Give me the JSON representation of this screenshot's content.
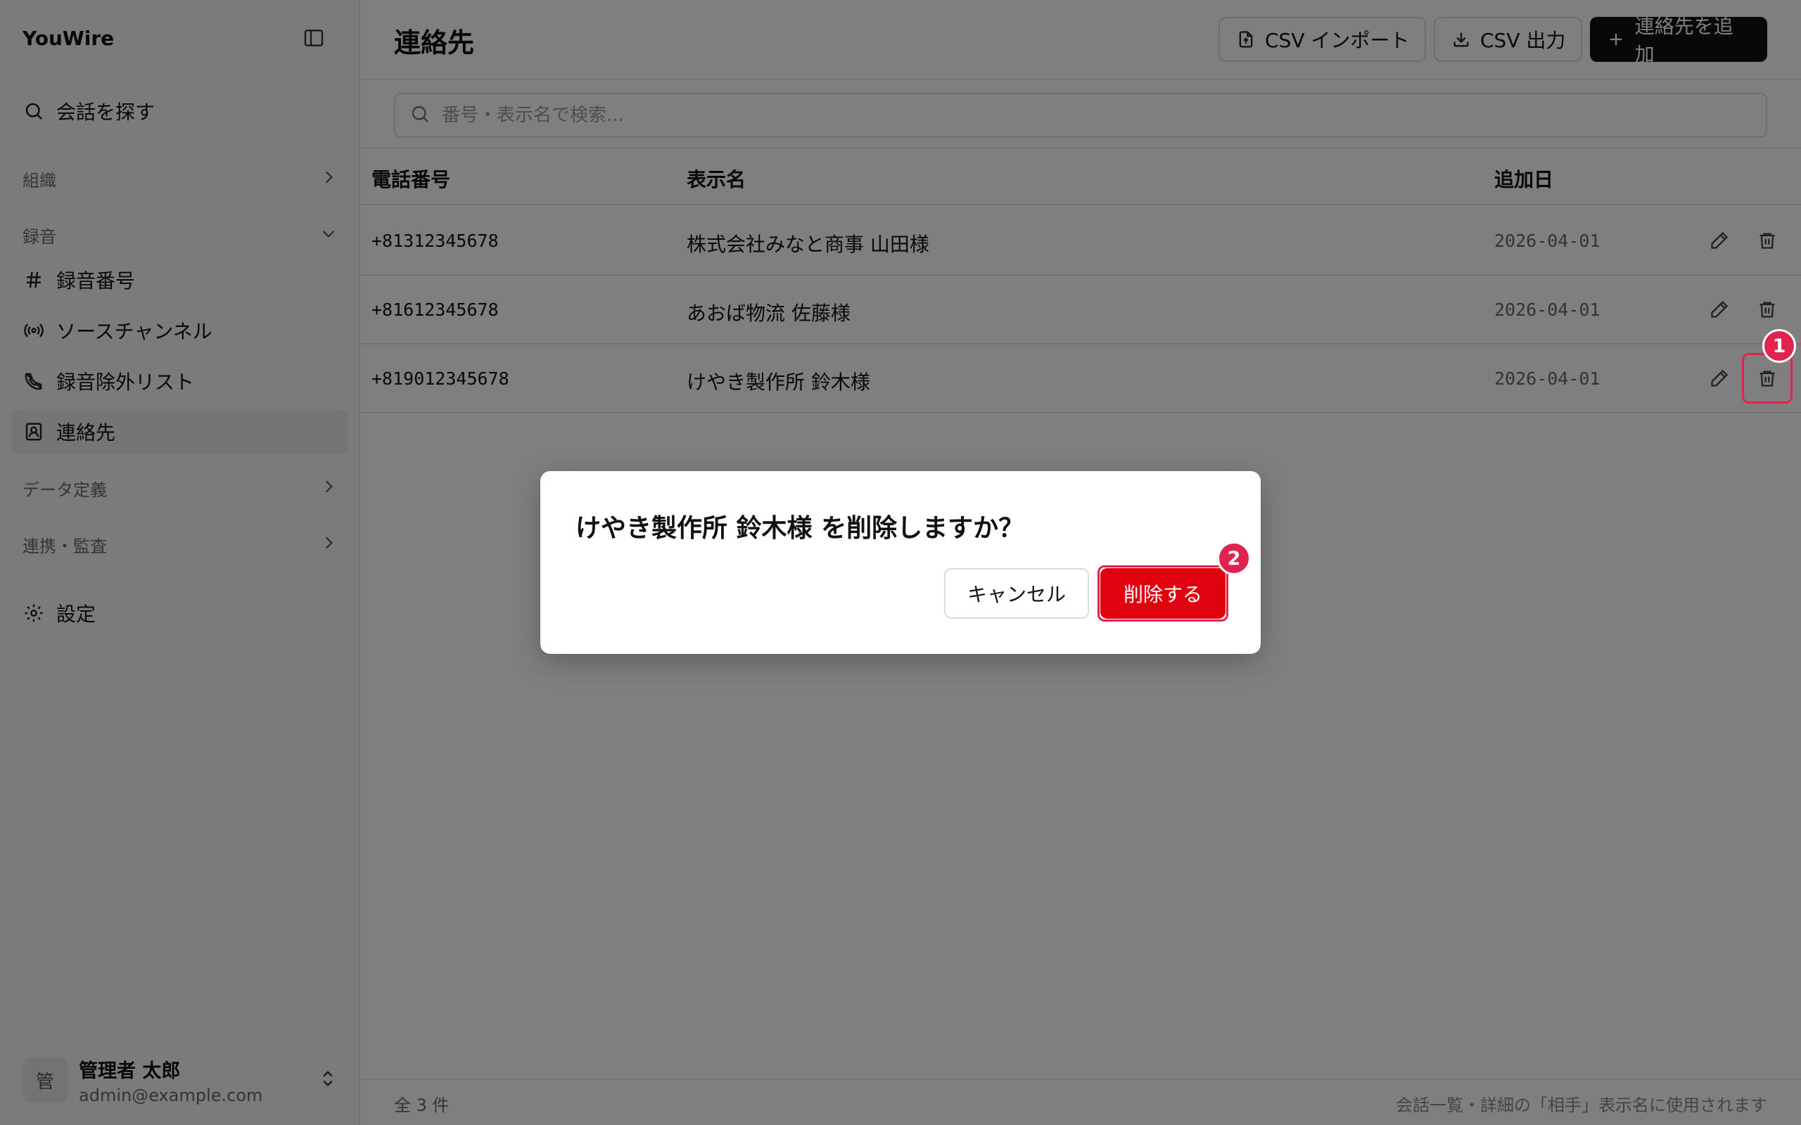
{
  "sidebar": {
    "brand": "YouWire",
    "search_label": "会話を探す",
    "group_org": "組織",
    "group_recording": "録音",
    "items": [
      {
        "label": "録音番号"
      },
      {
        "label": "ソースチャンネル"
      },
      {
        "label": "録音除外リスト"
      },
      {
        "label": "連絡先"
      }
    ],
    "group_data": "データ定義",
    "group_integration": "連携・監査",
    "settings_label": "設定",
    "user": {
      "avatar": "管",
      "name": "管理者 太郎",
      "email": "admin@example.com"
    }
  },
  "header": {
    "title": "連絡先",
    "csv_import": "CSV インポート",
    "csv_export": "CSV 出力",
    "add_contact": "連絡先を追加"
  },
  "search": {
    "placeholder": "番号・表示名で検索..."
  },
  "table": {
    "columns": {
      "phone": "電話番号",
      "name": "表示名",
      "added": "追加日"
    },
    "rows": [
      {
        "phone": "+81312345678",
        "name": "株式会社みなと商事 山田様",
        "added": "2026-04-01"
      },
      {
        "phone": "+81612345678",
        "name": "あおば物流 佐藤様",
        "added": "2026-04-01"
      },
      {
        "phone": "+819012345678",
        "name": "けやき製作所 鈴木様",
        "added": "2026-04-01"
      }
    ]
  },
  "footer": {
    "count": "全 3 件",
    "note": "会話一覧・詳細の「相手」表示名に使用されます"
  },
  "dialog": {
    "title": "けやき製作所 鈴木様 を削除しますか？",
    "cancel": "キャンセル",
    "confirm": "削除する"
  },
  "markers": {
    "m1": "1",
    "m2": "2"
  },
  "colors": {
    "danger": "#e0020f",
    "marker": "#e0244f",
    "primary": "#111111"
  }
}
